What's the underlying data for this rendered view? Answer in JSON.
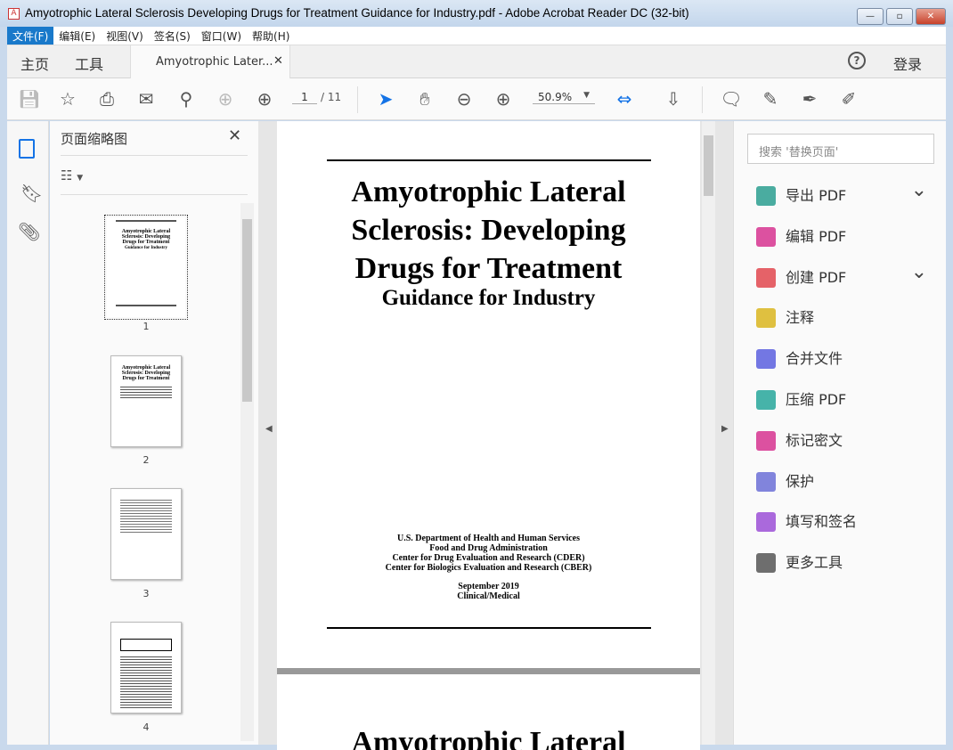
{
  "window": {
    "title": "Amyotrophic Lateral Sclerosis Developing Drugs for Treatment Guidance for Industry.pdf - Adobe Acrobat Reader DC (32-bit)"
  },
  "menu": [
    "文件(F)",
    "编辑(E)",
    "视图(V)",
    "签名(S)",
    "窗口(W)",
    "帮助(H)"
  ],
  "tabs": {
    "home": "主页",
    "tools": "工具",
    "doc": "Amyotrophic Later...",
    "login": "登录"
  },
  "toolbar": {
    "page_current": "1",
    "page_total": "/ 11",
    "zoom": "50.9%"
  },
  "thumbnails": {
    "title": "页面缩略图",
    "pages": [
      "1",
      "2",
      "3",
      "4"
    ]
  },
  "document": {
    "title_lines": [
      "Amyotrophic Lateral",
      "Sclerosis: Developing",
      "Drugs for Treatment"
    ],
    "subtitle": "Guidance for Industry",
    "agency_lines": [
      "U.S. Department of Health and Human Services",
      "Food and Drug Administration",
      "Center for Drug Evaluation and Research (CDER)",
      "Center for Biologics Evaluation and Research (CBER)"
    ],
    "date": "September 2019",
    "category": "Clinical/Medical",
    "page2_title": "Amyotrophic Lateral"
  },
  "tools_panel": {
    "search_placeholder": "搜索 '替换页面'",
    "items": [
      {
        "label": "导出 PDF",
        "color": "#2a9d8f",
        "chevron": true
      },
      {
        "label": "编辑 PDF",
        "color": "#d6338f",
        "chevron": false
      },
      {
        "label": "创建 PDF",
        "color": "#e0464e",
        "chevron": true
      },
      {
        "label": "注释",
        "color": "#d9b51f",
        "chevron": false
      },
      {
        "label": "合并文件",
        "color": "#5b5fde",
        "chevron": false
      },
      {
        "label": "压缩 PDF",
        "color": "#26a69a",
        "chevron": false
      },
      {
        "label": "标记密文",
        "color": "#d6338f",
        "chevron": false
      },
      {
        "label": "保护",
        "color": "#6b6fd6",
        "chevron": false
      },
      {
        "label": "填写和签名",
        "color": "#9b4fd6",
        "chevron": false
      },
      {
        "label": "更多工具",
        "color": "#555555",
        "chevron": false
      }
    ]
  }
}
